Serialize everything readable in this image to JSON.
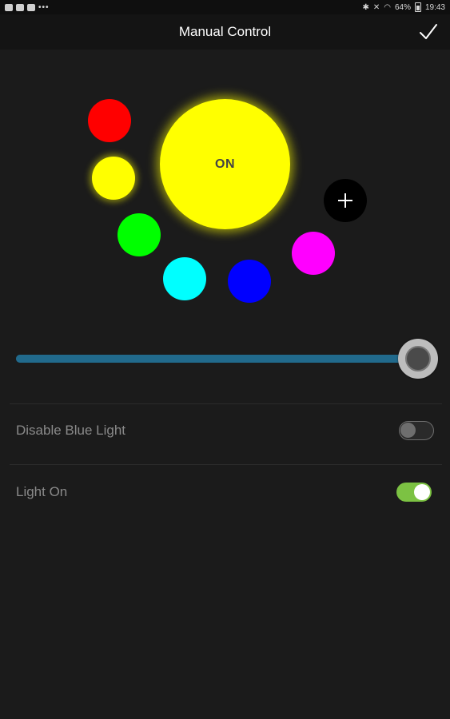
{
  "status_bar": {
    "battery_text": "64%",
    "time": "19:43",
    "icons": [
      "gallery-icon",
      "youtube-icon",
      "youtube-icon",
      "more-icon",
      "bluetooth-icon",
      "mute-icon",
      "wifi-icon",
      "battery-icon"
    ]
  },
  "header": {
    "title": "Manual Control",
    "confirm_icon": "checkmark-icon"
  },
  "color_picker": {
    "main_light_label": "ON",
    "main_light_color": "#ffff00",
    "swatches": [
      {
        "name": "red",
        "color": "#ff0000"
      },
      {
        "name": "yellow",
        "color": "#ffff00"
      },
      {
        "name": "green",
        "color": "#00ff00"
      },
      {
        "name": "cyan",
        "color": "#00ffff"
      },
      {
        "name": "blue",
        "color": "#0000ff"
      },
      {
        "name": "magenta",
        "color": "#ff00ff"
      }
    ],
    "add_icon": "plus-icon"
  },
  "brightness": {
    "value_fraction": 1.0,
    "track_color": "#216a8c"
  },
  "settings": [
    {
      "label": "Disable Blue Light",
      "enabled": false
    },
    {
      "label": "Light On",
      "enabled": true,
      "accent": "#7cc243"
    }
  ]
}
